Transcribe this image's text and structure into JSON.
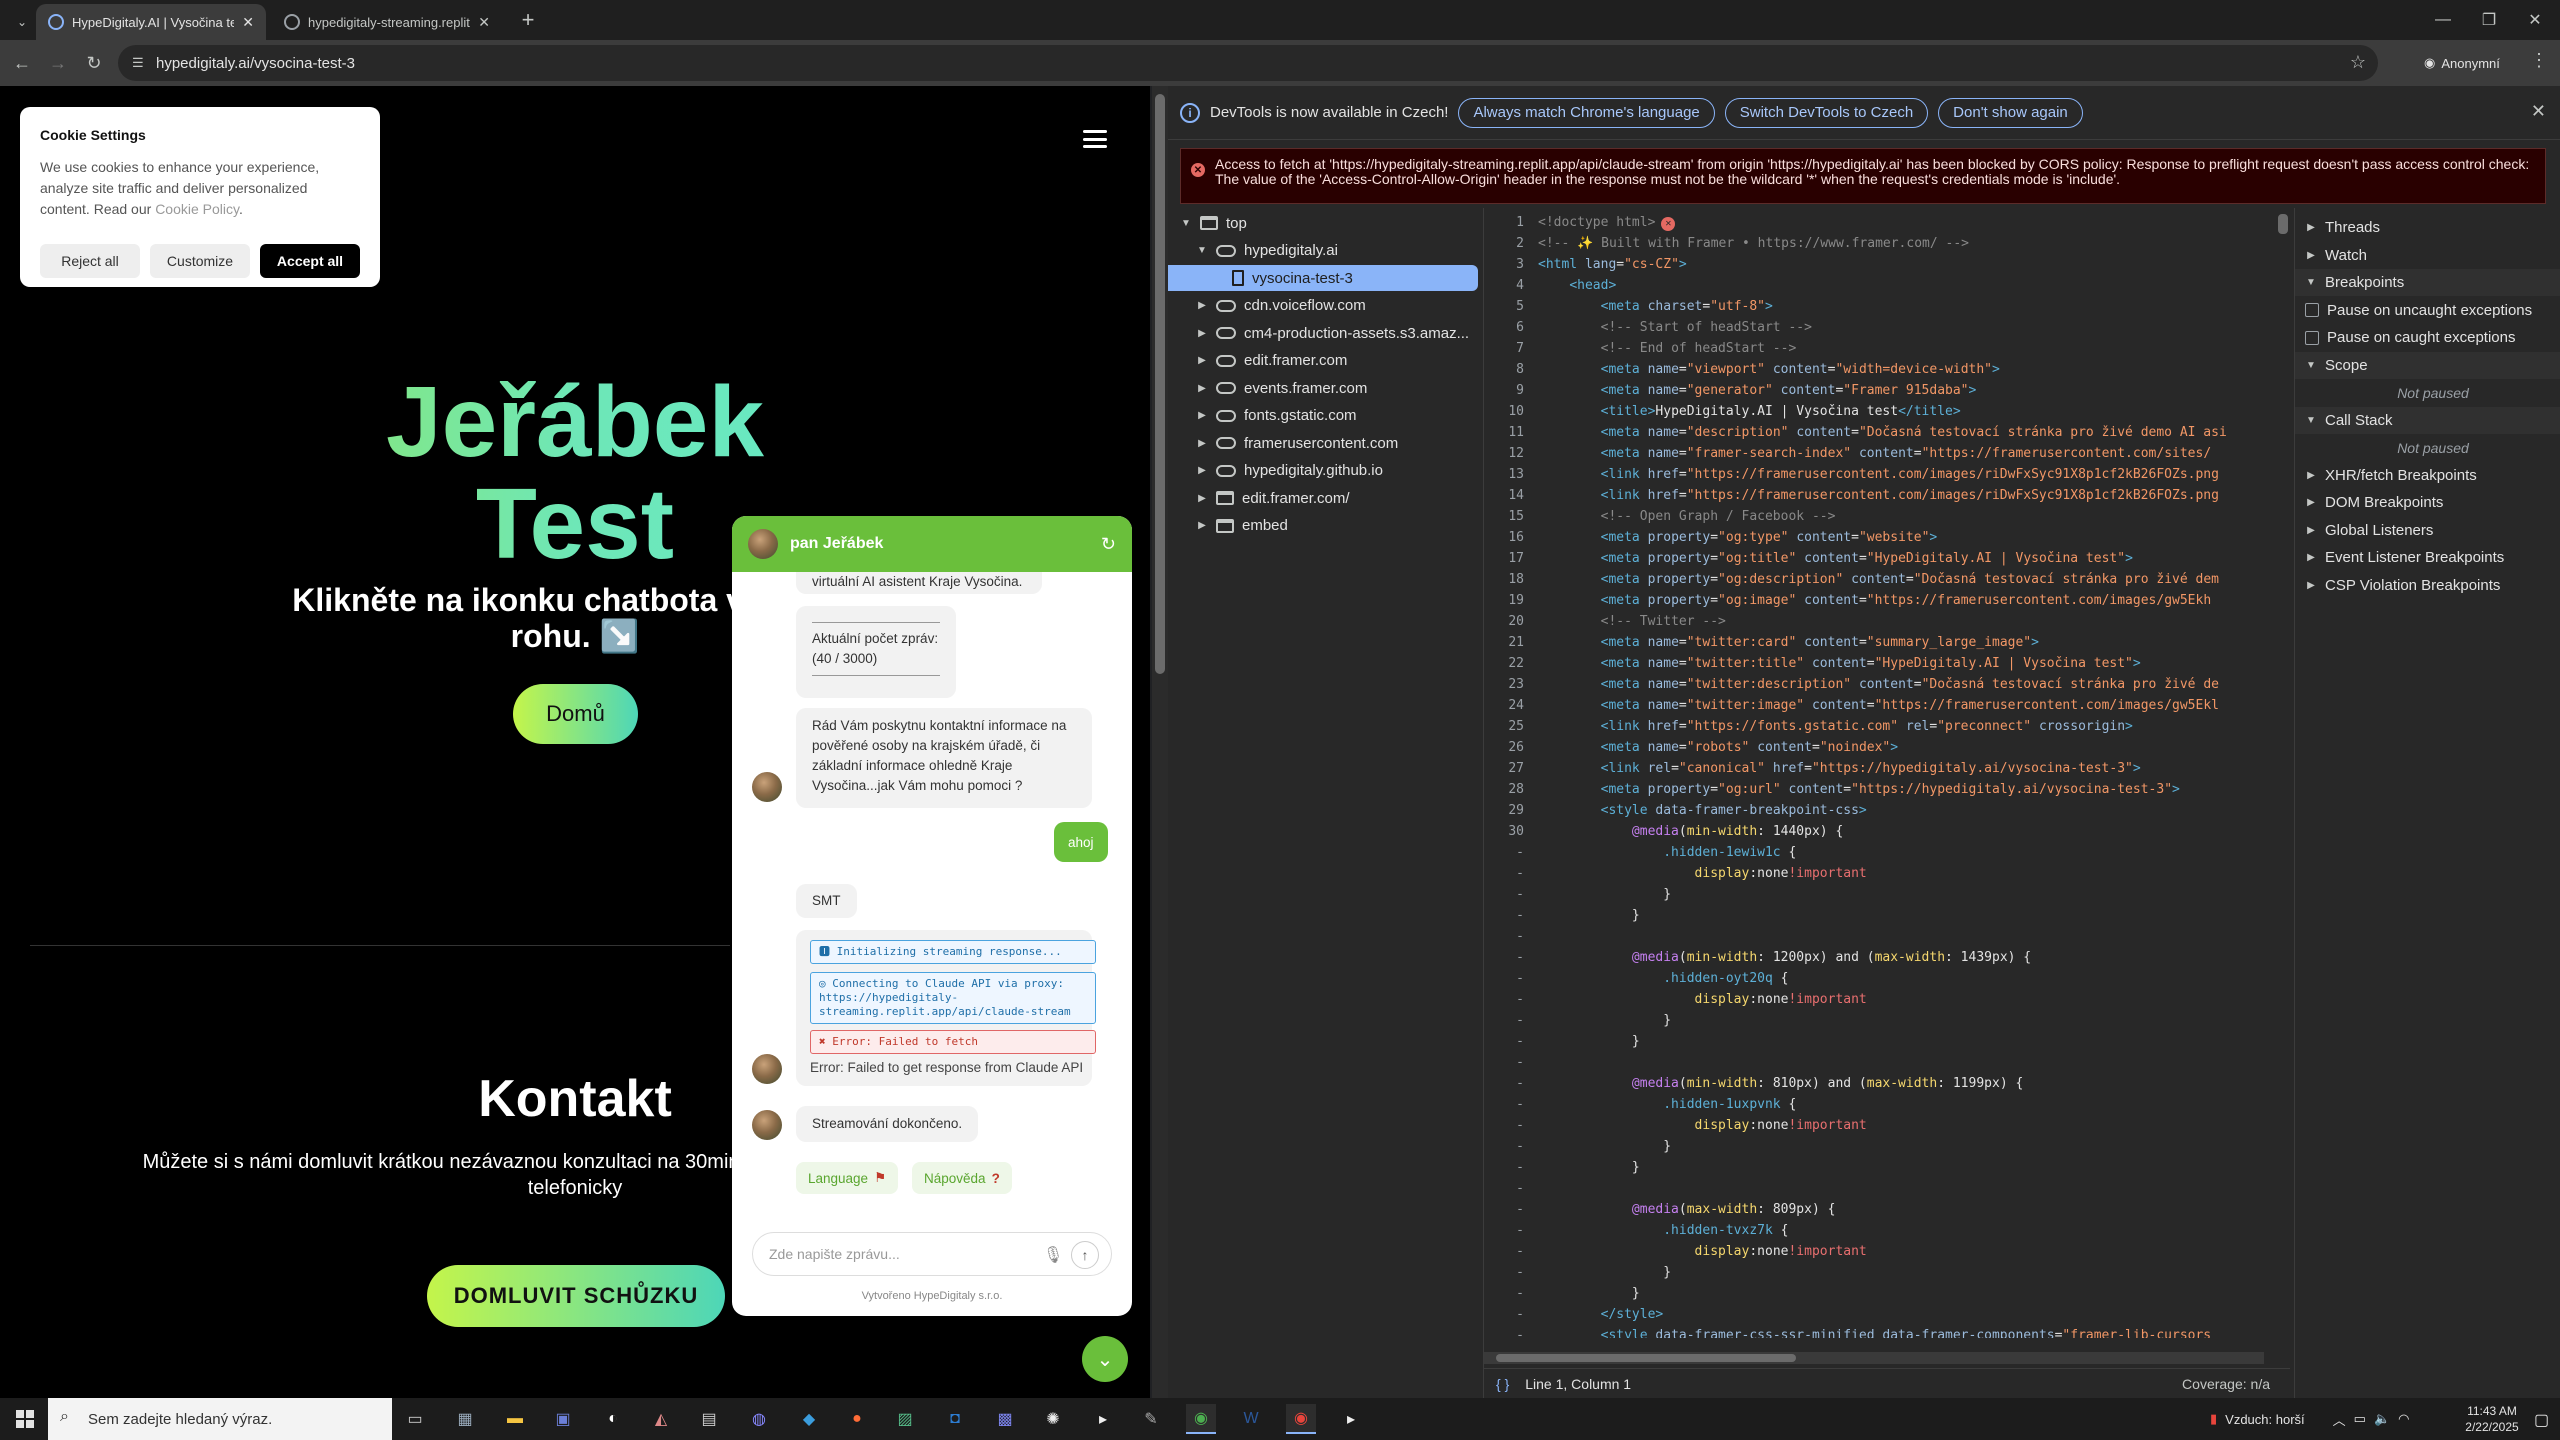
{
  "browser": {
    "tabs": [
      {
        "title": "HypeDigitaly.AI | Vysočina test",
        "active": true
      },
      {
        "title": "hypedigitaly-streaming.replit.app",
        "active": false
      }
    ],
    "url": "hypedigitaly.ai/vysocina-test-3",
    "profile_label": "Anonymní"
  },
  "cookie": {
    "title": "Cookie Settings",
    "text": "We use cookies to enhance your experience, analyze site traffic and deliver personalized content. Read our",
    "link": "Cookie Policy",
    "reject": "Reject all",
    "customize": "Customize",
    "accept": "Accept all"
  },
  "hero": {
    "title_line1": "Jeřábek",
    "title_line2": "Test",
    "subtitle": "Klikněte na ikonku chatbota v dolním rohu. ↘️",
    "home_button": "Domů"
  },
  "contact": {
    "title": "Kontakt",
    "text": "Můžete si s námi domluvit krátkou nezávaznou konzultaci na 30min či nás zkontaktovat emailem / telefonicky",
    "button": "DOMLUVIT SCHŮZKU"
  },
  "chat": {
    "bot_name": "pan Jeřábek",
    "msg_intro_tail": "virtuální AI asistent Kraje Vysočina.",
    "msg_count_label": "Aktuální počet zpráv:",
    "msg_count_value": "(40 / 3000)",
    "msg_info": "Rád Vám poskytnu kontaktní informace na pověřené osoby na krajském úřadě, či základní informace ohledně Kraje Vysočina...jak Vám mohu pomoci ?",
    "user_msg": "ahoj",
    "msg_smt": "SMT",
    "log_init": "Initializing streaming response...",
    "log_connect": "Connecting to Claude API via proxy: https://hypedigitaly-streaming.replit.app/api/claude-stream",
    "log_error": "Error: Failed to fetch",
    "error_text": "Error: Failed to get response from Claude API",
    "msg_done": "Streamování dokončeno.",
    "chip_language": "Language",
    "chip_help": "Nápověda",
    "input_placeholder": "Zde napište zprávu...",
    "credit": "Vytvořeno HypeDigitaly s.r.o."
  },
  "devtools": {
    "info_text": "DevTools is now available in Czech!",
    "btn_match": "Always match Chrome's language",
    "btn_switch": "Switch DevTools to Czech",
    "btn_dont": "Don't show again",
    "cors_error": "Access to fetch at 'https://hypedigitaly-streaming.replit.app/api/claude-stream' from origin 'https://hypedigitaly.ai' has been blocked by CORS policy: Response to preflight request doesn't pass access control check: The value of the 'Access-Control-Allow-Origin' header in the response must not be the wildcard '*' when the request's credentials mode is 'include'.",
    "tree": [
      {
        "label": "top",
        "icon": "frame",
        "arrow": "▼",
        "level": 0
      },
      {
        "label": "hypedigitaly.ai",
        "icon": "cloud",
        "arrow": "▼",
        "level": 1
      },
      {
        "label": "vysocina-test-3",
        "icon": "file",
        "arrow": "",
        "level": 2,
        "selected": true
      },
      {
        "label": "cdn.voiceflow.com",
        "icon": "cloud",
        "arrow": "▶",
        "level": 1
      },
      {
        "label": "cm4-production-assets.s3.amaz...",
        "icon": "cloud",
        "arrow": "▶",
        "level": 1
      },
      {
        "label": "edit.framer.com",
        "icon": "cloud",
        "arrow": "▶",
        "level": 1
      },
      {
        "label": "events.framer.com",
        "icon": "cloud",
        "arrow": "▶",
        "level": 1
      },
      {
        "label": "fonts.gstatic.com",
        "icon": "cloud",
        "arrow": "▶",
        "level": 1
      },
      {
        "label": "framerusercontent.com",
        "icon": "cloud",
        "arrow": "▶",
        "level": 1
      },
      {
        "label": "hypedigitaly.github.io",
        "icon": "cloud",
        "arrow": "▶",
        "level": 1
      },
      {
        "label": "edit.framer.com/",
        "icon": "frame",
        "arrow": "▶",
        "level": 1
      },
      {
        "label": "embed",
        "icon": "frame",
        "arrow": "▶",
        "level": 1
      }
    ],
    "code": [
      {
        "ln": "1",
        "html": "<span class='cmt'>&lt;!doctype html&gt;</span><span class='err-dot'>✕</span>"
      },
      {
        "ln": "2",
        "html": "<span class='cmt'>&lt;!-- ✨ Built with Framer • https://www.framer.com/ --&gt;</span>"
      },
      {
        "ln": "3",
        "html": "<span class='tag'>&lt;html</span> <span class='attr'>lang</span>=<span class='val'>\"cs-CZ\"</span><span class='tag'>&gt;</span>"
      },
      {
        "ln": "4",
        "html": "    <span class='tag'>&lt;head&gt;</span>"
      },
      {
        "ln": "5",
        "html": "        <span class='tag'>&lt;meta</span> <span class='attr'>charset</span>=<span class='val'>\"utf-8\"</span><span class='tag'>&gt;</span>"
      },
      {
        "ln": "6",
        "html": "        <span class='cmt'>&lt;!-- Start of headStart --&gt;</span>"
      },
      {
        "ln": "7",
        "html": "        <span class='cmt'>&lt;!-- End of headStart --&gt;</span>"
      },
      {
        "ln": "8",
        "html": "        <span class='tag'>&lt;meta</span> <span class='attr'>name</span>=<span class='val'>\"viewport\"</span> <span class='attr'>content</span>=<span class='val'>\"width=device-width\"</span><span class='tag'>&gt;</span>"
      },
      {
        "ln": "9",
        "html": "        <span class='tag'>&lt;meta</span> <span class='attr'>name</span>=<span class='val'>\"generator\"</span> <span class='attr'>content</span>=<span class='val'>\"Framer 915daba\"</span><span class='tag'>&gt;</span>"
      },
      {
        "ln": "10",
        "html": "        <span class='tag'>&lt;title&gt;</span>HypeDigitaly.AI | Vysočina test<span class='tag'>&lt;/title&gt;</span>"
      },
      {
        "ln": "11",
        "html": "        <span class='tag'>&lt;meta</span> <span class='attr'>name</span>=<span class='val'>\"description\"</span> <span class='attr'>content</span>=<span class='val'>\"Dočasná testovací stránka pro živé demo AI asi</span>"
      },
      {
        "ln": "12",
        "html": "        <span class='tag'>&lt;meta</span> <span class='attr'>name</span>=<span class='val'>\"framer-search-index\"</span> <span class='attr'>content</span>=<span class='val'>\"https://framerusercontent.com/sites/</span>"
      },
      {
        "ln": "13",
        "html": "        <span class='tag'>&lt;link</span> <span class='attr'>href</span>=<span class='val'>\"https://framerusercontent.com/images/riDwFxSyc91X8p1cf2kB26FOZs.png</span>"
      },
      {
        "ln": "14",
        "html": "        <span class='tag'>&lt;link</span> <span class='attr'>href</span>=<span class='val'>\"https://framerusercontent.com/images/riDwFxSyc91X8p1cf2kB26FOZs.png</span>"
      },
      {
        "ln": "15",
        "html": "        <span class='cmt'>&lt;!-- Open Graph / Facebook --&gt;</span>"
      },
      {
        "ln": "16",
        "html": "        <span class='tag'>&lt;meta</span> <span class='attr'>property</span>=<span class='val'>\"og:type\"</span> <span class='attr'>content</span>=<span class='val'>\"website\"</span><span class='tag'>&gt;</span>"
      },
      {
        "ln": "17",
        "html": "        <span class='tag'>&lt;meta</span> <span class='attr'>property</span>=<span class='val'>\"og:title\"</span> <span class='attr'>content</span>=<span class='val'>\"HypeDigitaly.AI | Vysočina test\"</span><span class='tag'>&gt;</span>"
      },
      {
        "ln": "18",
        "html": "        <span class='tag'>&lt;meta</span> <span class='attr'>property</span>=<span class='val'>\"og:description\"</span> <span class='attr'>content</span>=<span class='val'>\"Dočasná testovací stránka pro živé dem</span>"
      },
      {
        "ln": "19",
        "html": "        <span class='tag'>&lt;meta</span> <span class='attr'>property</span>=<span class='val'>\"og:image\"</span> <span class='attr'>content</span>=<span class='val'>\"https://framerusercontent.com/images/gw5Ekh</span>"
      },
      {
        "ln": "20",
        "html": "        <span class='cmt'>&lt;!-- Twitter --&gt;</span>"
      },
      {
        "ln": "21",
        "html": "        <span class='tag'>&lt;meta</span> <span class='attr'>name</span>=<span class='val'>\"twitter:card\"</span> <span class='attr'>content</span>=<span class='val'>\"summary_large_image\"</span><span class='tag'>&gt;</span>"
      },
      {
        "ln": "22",
        "html": "        <span class='tag'>&lt;meta</span> <span class='attr'>name</span>=<span class='val'>\"twitter:title\"</span> <span class='attr'>content</span>=<span class='val'>\"HypeDigitaly.AI | Vysočina test\"</span><span class='tag'>&gt;</span>"
      },
      {
        "ln": "23",
        "html": "        <span class='tag'>&lt;meta</span> <span class='attr'>name</span>=<span class='val'>\"twitter:description\"</span> <span class='attr'>content</span>=<span class='val'>\"Dočasná testovací stránka pro živé de</span>"
      },
      {
        "ln": "24",
        "html": "        <span class='tag'>&lt;meta</span> <span class='attr'>name</span>=<span class='val'>\"twitter:image\"</span> <span class='attr'>content</span>=<span class='val'>\"https://framerusercontent.com/images/gw5Ekl</span>"
      },
      {
        "ln": "25",
        "html": "        <span class='tag'>&lt;link</span> <span class='attr'>href</span>=<span class='val'>\"https://fonts.gstatic.com\"</span> <span class='attr'>rel</span>=<span class='val'>\"preconnect\"</span> <span class='attr'>crossorigin</span><span class='tag'>&gt;</span>"
      },
      {
        "ln": "26",
        "html": "        <span class='tag'>&lt;meta</span> <span class='attr'>name</span>=<span class='val'>\"robots\"</span> <span class='attr'>content</span>=<span class='val'>\"noindex\"</span><span class='tag'>&gt;</span>"
      },
      {
        "ln": "27",
        "html": "        <span class='tag'>&lt;link</span> <span class='attr'>rel</span>=<span class='val'>\"canonical\"</span> <span class='attr'>href</span>=<span class='val'>\"https://hypedigitaly.ai/vysocina-test-3\"</span><span class='tag'>&gt;</span>"
      },
      {
        "ln": "28",
        "html": "        <span class='tag'>&lt;meta</span> <span class='attr'>property</span>=<span class='val'>\"og:url\"</span> <span class='attr'>content</span>=<span class='val'>\"https://hypedigitaly.ai/vysocina-test-3\"</span><span class='tag'>&gt;</span>"
      },
      {
        "ln": "29",
        "html": "        <span class='tag'>&lt;style</span> <span class='attr'>data-framer-breakpoint-css</span><span class='tag'>&gt;</span>"
      },
      {
        "ln": "30",
        "html": "            <span class='sel-kw'>@media</span>(<span class='prop'>min-width</span>: 1440px) {"
      },
      {
        "ln": "-",
        "html": "                <span class='tag'>.hidden-1ewiw1c</span> {"
      },
      {
        "ln": "-",
        "html": "                    <span class='prop'>display</span>:none<span class='imp'>!important</span>"
      },
      {
        "ln": "-",
        "html": "                }"
      },
      {
        "ln": "-",
        "html": "            }"
      },
      {
        "ln": "-",
        "html": ""
      },
      {
        "ln": "-",
        "html": "            <span class='sel-kw'>@media</span>(<span class='prop'>min-width</span>: 1200px) and (<span class='prop'>max-width</span>: 1439px) {"
      },
      {
        "ln": "-",
        "html": "                <span class='tag'>.hidden-oyt20q</span> {"
      },
      {
        "ln": "-",
        "html": "                    <span class='prop'>display</span>:none<span class='imp'>!important</span>"
      },
      {
        "ln": "-",
        "html": "                }"
      },
      {
        "ln": "-",
        "html": "            }"
      },
      {
        "ln": "-",
        "html": ""
      },
      {
        "ln": "-",
        "html": "            <span class='sel-kw'>@media</span>(<span class='prop'>min-width</span>: 810px) and (<span class='prop'>max-width</span>: 1199px) {"
      },
      {
        "ln": "-",
        "html": "                <span class='tag'>.hidden-1uxpvnk</span> {"
      },
      {
        "ln": "-",
        "html": "                    <span class='prop'>display</span>:none<span class='imp'>!important</span>"
      },
      {
        "ln": "-",
        "html": "                }"
      },
      {
        "ln": "-",
        "html": "            }"
      },
      {
        "ln": "-",
        "html": ""
      },
      {
        "ln": "-",
        "html": "            <span class='sel-kw'>@media</span>(<span class='prop'>max-width</span>: 809px) {"
      },
      {
        "ln": "-",
        "html": "                <span class='tag'>.hidden-tvxz7k</span> {"
      },
      {
        "ln": "-",
        "html": "                    <span class='prop'>display</span>:none<span class='imp'>!important</span>"
      },
      {
        "ln": "-",
        "html": "                }"
      },
      {
        "ln": "-",
        "html": "            }"
      },
      {
        "ln": "-",
        "html": "        <span class='tag'>&lt;/style&gt;</span>"
      },
      {
        "ln": "-",
        "html": "        <span class='tag'>&lt;style</span> <span class='attr'>data-framer-css-ssr-minified</span> <span class='attr'>data-framer-components</span>=<span class='val'>\"framer-lib-cursors</span>"
      }
    ],
    "status_position": "Line 1, Column 1",
    "coverage": "Coverage: n/a",
    "debugger": [
      {
        "label": "Threads",
        "type": "section",
        "arrow": "▶"
      },
      {
        "label": "Watch",
        "type": "section",
        "arrow": "▶"
      },
      {
        "label": "Breakpoints",
        "type": "header",
        "arrow": "▼"
      },
      {
        "label": "Pause on uncaught exceptions",
        "type": "checkbox"
      },
      {
        "label": "Pause on caught exceptions",
        "type": "checkbox"
      },
      {
        "label": "Scope",
        "type": "header",
        "arrow": "▼"
      },
      {
        "label": "Not paused",
        "type": "note"
      },
      {
        "label": "Call Stack",
        "type": "header",
        "arrow": "▼"
      },
      {
        "label": "Not paused",
        "type": "note"
      },
      {
        "label": "XHR/fetch Breakpoints",
        "type": "section",
        "arrow": "▶"
      },
      {
        "label": "DOM Breakpoints",
        "type": "section",
        "arrow": "▶"
      },
      {
        "label": "Global Listeners",
        "type": "section",
        "arrow": "▶"
      },
      {
        "label": "Event Listener Breakpoints",
        "type": "section",
        "arrow": "▶"
      },
      {
        "label": "CSP Violation Breakpoints",
        "type": "section",
        "arrow": "▶"
      }
    ]
  },
  "taskbar": {
    "search_placeholder": "Sem zadejte hledaný výraz.",
    "weather": "Vzduch: horší",
    "time": "11:43 AM",
    "date": "2/22/2025"
  }
}
